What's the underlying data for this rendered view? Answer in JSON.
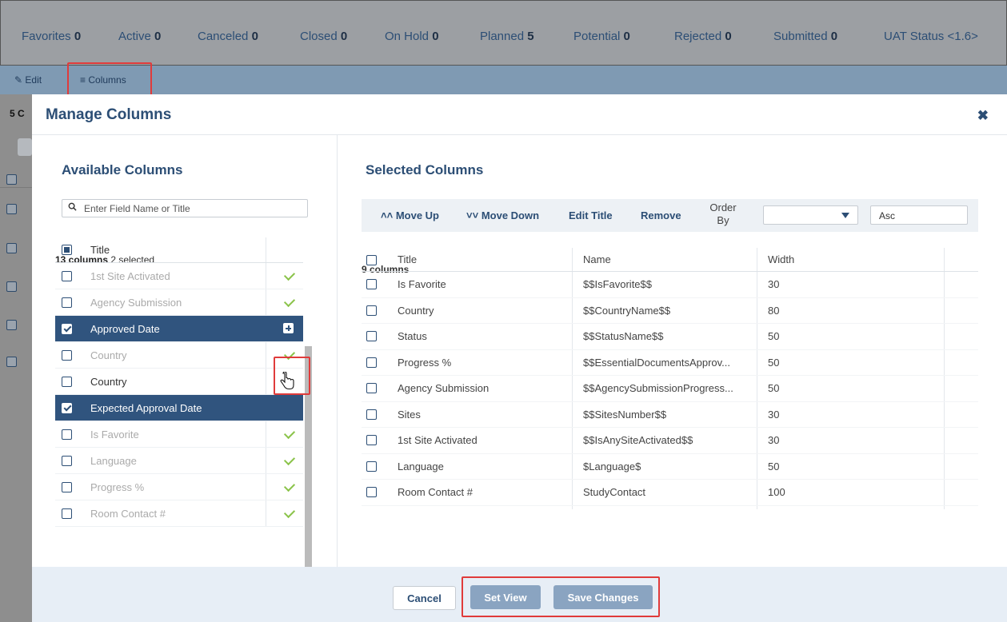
{
  "tabs": [
    {
      "label": "Favorites",
      "count": "0"
    },
    {
      "label": "Active",
      "count": "0"
    },
    {
      "label": "Canceled",
      "count": "0"
    },
    {
      "label": "Closed",
      "count": "0"
    },
    {
      "label": "On Hold",
      "count": "0"
    },
    {
      "label": "Planned",
      "count": "5"
    },
    {
      "label": "Potential",
      "count": "0"
    },
    {
      "label": "Rejected",
      "count": "0"
    },
    {
      "label": "Submitted",
      "count": "0"
    },
    {
      "label": "UAT Status <1.6>",
      "count": ""
    }
  ],
  "toolbar": {
    "edit_label": "Edit",
    "columns_label": "Columns"
  },
  "background": {
    "count_text": "5 C"
  },
  "modal": {
    "title": "Manage Columns",
    "available": {
      "title": "Available Columns",
      "search_placeholder": "Enter Field Name or Title",
      "count_bold": "13 columns",
      "count_rest": "2 selected",
      "header_title": "Title",
      "items": [
        {
          "label": "1st Site Activated",
          "state": "used"
        },
        {
          "label": "Agency Submission",
          "state": "used"
        },
        {
          "label": "Approved Date",
          "state": "selected"
        },
        {
          "label": "Country",
          "state": "used"
        },
        {
          "label": "Country",
          "state": "normal"
        },
        {
          "label": "Expected Approval Date",
          "state": "selected"
        },
        {
          "label": "Is Favorite",
          "state": "used"
        },
        {
          "label": "Language",
          "state": "used"
        },
        {
          "label": "Progress %",
          "state": "used"
        },
        {
          "label": "Room Contact #",
          "state": "used"
        }
      ]
    },
    "selected": {
      "title": "Selected Columns",
      "actions": {
        "move_up": "Move Up",
        "move_down": "Move Down",
        "edit_title": "Edit Title",
        "remove": "Remove",
        "order_by": "Order By",
        "order_by_value": "",
        "direction": "Asc"
      },
      "count_text": "9 columns",
      "columns_header": [
        "Title",
        "Name",
        "Width"
      ],
      "rows": [
        {
          "title": "Is Favorite",
          "name": "$$IsFavorite$$",
          "width": "30"
        },
        {
          "title": "Country",
          "name": "$$CountryName$$",
          "width": "80"
        },
        {
          "title": "Status",
          "name": "$$StatusName$$",
          "width": "50"
        },
        {
          "title": "Progress %",
          "name": "$$EssentialDocumentsApprov...",
          "width": "50"
        },
        {
          "title": "Agency Submission",
          "name": "$$AgencySubmissionProgress...",
          "width": "50"
        },
        {
          "title": "Sites",
          "name": "$$SitesNumber$$",
          "width": "30"
        },
        {
          "title": "1st Site Activated",
          "name": "$$IsAnySiteActivated$$",
          "width": "30"
        },
        {
          "title": "Language",
          "name": "$Language$",
          "width": "50"
        },
        {
          "title": "Room Contact #",
          "name": "StudyContact",
          "width": "100"
        }
      ]
    },
    "footer": {
      "cancel": "Cancel",
      "set_view": "Set View",
      "save_changes": "Save Changes"
    }
  },
  "colors": {
    "accent": "#2c4e75",
    "selected_row": "#30547e",
    "check": "#8bc34a",
    "highlight": "#e03b3b"
  }
}
